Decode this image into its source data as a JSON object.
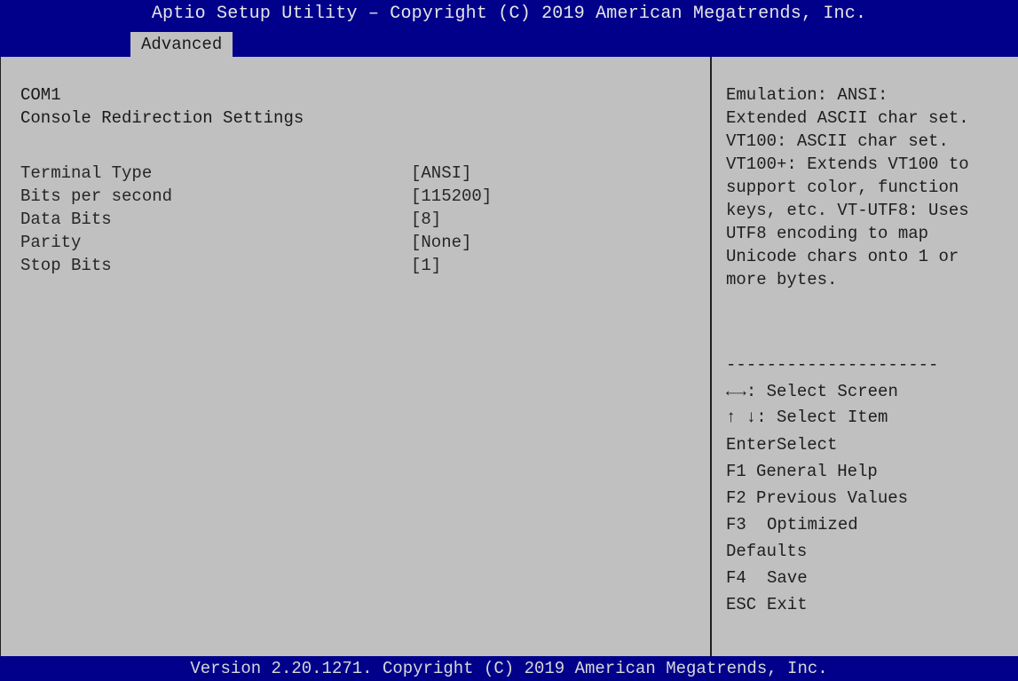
{
  "header": {
    "title": "Aptio Setup Utility – Copyright (C) 2019 American Megatrends, Inc.",
    "active_tab": "Advanced"
  },
  "main": {
    "section": "COM1",
    "subtitle": "Console Redirection Settings",
    "settings": [
      {
        "label": "Terminal Type",
        "value": "[ANSI]"
      },
      {
        "label": "Bits per second",
        "value": "[115200]"
      },
      {
        "label": "Data Bits",
        "value": "[8]"
      },
      {
        "label": "Parity",
        "value": "[None]"
      },
      {
        "label": "Stop Bits",
        "value": "[1]"
      }
    ]
  },
  "help_panel": {
    "description": [
      "Emulation: ANSI:",
      "Extended ASCII char set.",
      "VT100: ASCII char set.",
      "VT100+: Extends VT100 to",
      "support color, function",
      "keys, etc. VT-UTF8: Uses",
      "UTF8 encoding to map",
      "Unicode chars onto 1 or",
      "more bytes."
    ],
    "separator": "---------------------",
    "keys": [
      {
        "key": "←→",
        "desc": ": Select Screen"
      },
      {
        "key": "↑ ↓",
        "desc": ": Select Item"
      },
      {
        "key": "Enter",
        "desc": "Select"
      },
      {
        "key": "F1",
        "desc": "General Help"
      },
      {
        "key": "F2",
        "desc": "Previous Values"
      },
      {
        "key": "F3",
        "desc": "Optimized"
      },
      {
        "key": "",
        "desc": "Defaults"
      },
      {
        "key": "F4",
        "desc": "Save"
      },
      {
        "key": "ESC",
        "desc": "Exit"
      }
    ]
  },
  "footer": {
    "version": "Version 2.20.1271. Copyright (C) 2019 American Megatrends, Inc."
  }
}
